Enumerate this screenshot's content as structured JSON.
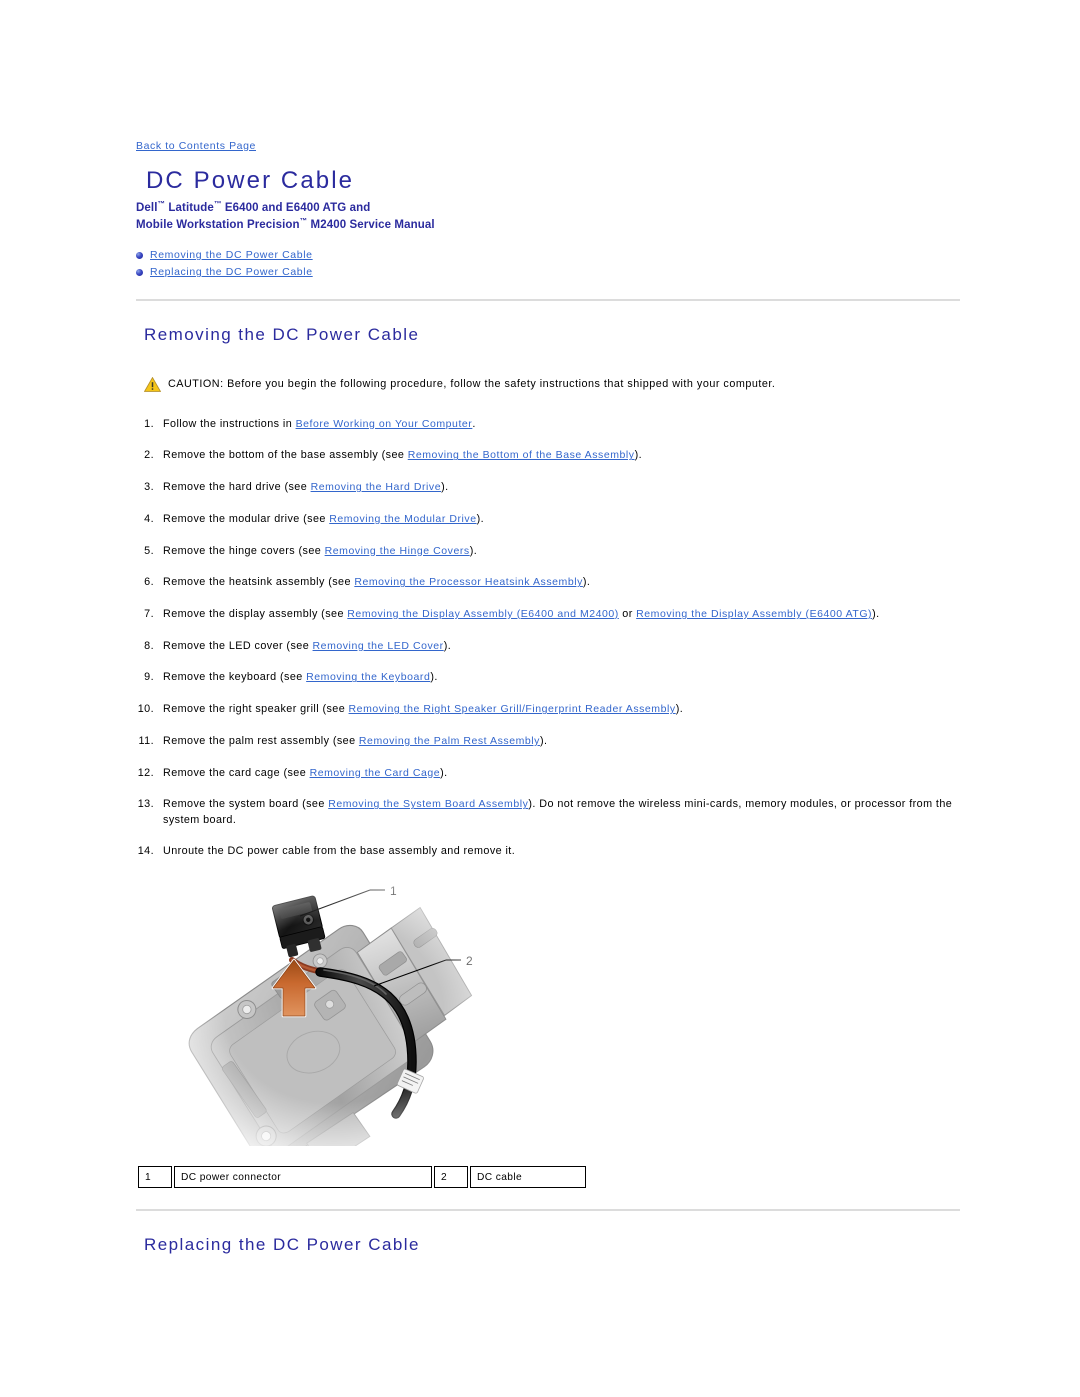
{
  "back_link": "Back to Contents Page",
  "title": "DC Power Cable",
  "subtitle_line1_pre": "Dell",
  "subtitle_line1_mid": " Latitude",
  "subtitle_line1_post": " E6400 and E6400 ATG and",
  "subtitle_line2_pre": "Mobile Workstation Precision",
  "subtitle_line2_post": " M2400 Service Manual",
  "trademark": "™",
  "toc": {
    "items": [
      {
        "label": "Removing the DC Power Cable"
      },
      {
        "label": "Replacing the DC Power Cable"
      }
    ]
  },
  "sections": {
    "removing_heading": "Removing the DC Power Cable",
    "replacing_heading": "Replacing the DC Power Cable"
  },
  "caution": {
    "icon": "warning-triangle-icon",
    "label": "CAUTION:",
    "text": " Before you begin the following procedure, follow the safety instructions that shipped with your computer."
  },
  "steps": [
    {
      "num": "1.",
      "parts": [
        {
          "t": "Follow the instructions in ",
          "link": false
        },
        {
          "t": "Before Working on Your Computer",
          "link": true
        },
        {
          "t": ".",
          "link": false
        }
      ]
    },
    {
      "num": "2.",
      "parts": [
        {
          "t": "Remove the bottom of the base assembly (see ",
          "link": false
        },
        {
          "t": "Removing the Bottom of the Base Assembly",
          "link": true
        },
        {
          "t": ").",
          "link": false
        }
      ]
    },
    {
      "num": "3.",
      "parts": [
        {
          "t": "Remove the hard drive (see ",
          "link": false
        },
        {
          "t": "Removing the Hard Drive",
          "link": true
        },
        {
          "t": ").",
          "link": false
        }
      ]
    },
    {
      "num": "4.",
      "parts": [
        {
          "t": "Remove the modular drive (see ",
          "link": false
        },
        {
          "t": "Removing the Modular Drive",
          "link": true
        },
        {
          "t": ").",
          "link": false
        }
      ]
    },
    {
      "num": "5.",
      "parts": [
        {
          "t": "Remove the hinge covers (see ",
          "link": false
        },
        {
          "t": "Removing the Hinge Covers",
          "link": true
        },
        {
          "t": ").",
          "link": false
        }
      ]
    },
    {
      "num": "6.",
      "parts": [
        {
          "t": "Remove the heatsink assembly (see ",
          "link": false
        },
        {
          "t": "Removing the Processor Heatsink Assembly",
          "link": true
        },
        {
          "t": ").",
          "link": false
        }
      ]
    },
    {
      "num": "7.",
      "parts": [
        {
          "t": "Remove the display assembly (see ",
          "link": false
        },
        {
          "t": "Removing the Display Assembly (E6400 and M2400)",
          "link": true
        },
        {
          "t": " or ",
          "link": false
        },
        {
          "t": "Removing the Display Assembly (E6400 ATG)",
          "link": true
        },
        {
          "t": ").",
          "link": false
        }
      ]
    },
    {
      "num": "8.",
      "parts": [
        {
          "t": "Remove the LED cover (see ",
          "link": false
        },
        {
          "t": "Removing the LED Cover",
          "link": true
        },
        {
          "t": ").",
          "link": false
        }
      ]
    },
    {
      "num": "9.",
      "parts": [
        {
          "t": "Remove the keyboard (see ",
          "link": false
        },
        {
          "t": "Removing the Keyboard",
          "link": true
        },
        {
          "t": ").",
          "link": false
        }
      ]
    },
    {
      "num": "10.",
      "parts": [
        {
          "t": "Remove the right speaker grill (see ",
          "link": false
        },
        {
          "t": "Removing the Right Speaker Grill/Fingerprint Reader Assembly",
          "link": true
        },
        {
          "t": ").",
          "link": false
        }
      ]
    },
    {
      "num": "11.",
      "parts": [
        {
          "t": "Remove the palm rest assembly (see ",
          "link": false
        },
        {
          "t": "Removing the Palm Rest Assembly",
          "link": true
        },
        {
          "t": ").",
          "link": false
        }
      ]
    },
    {
      "num": "12.",
      "parts": [
        {
          "t": "Remove the card cage (see ",
          "link": false
        },
        {
          "t": "Removing the Card Cage",
          "link": true
        },
        {
          "t": ").",
          "link": false
        }
      ]
    },
    {
      "num": "13.",
      "parts": [
        {
          "t": "Remove the system board (see ",
          "link": false
        },
        {
          "t": "Removing the System Board Assembly",
          "link": true
        },
        {
          "t": "). Do not remove the wireless mini-cards, memory modules, or processor from the system board.",
          "link": false
        }
      ]
    },
    {
      "num": "14.",
      "parts": [
        {
          "t": "Unroute the DC power cable from the base assembly and remove it.",
          "link": false
        }
      ]
    }
  ],
  "figure": {
    "alt": "DC power cable routed in laptop base assembly",
    "callouts": [
      {
        "id": "1",
        "target": "dc-power-connector"
      },
      {
        "id": "2",
        "target": "dc-cable"
      }
    ],
    "arrow": "lift-arrow-up"
  },
  "legend": {
    "cells": [
      {
        "num": "1",
        "label": "DC power connector"
      },
      {
        "num": "2",
        "label": "DC cable"
      }
    ]
  },
  "colors": {
    "heading_blue": "#2B2B9E",
    "link_blue": "#3366CC",
    "rule_gray": "#DCDCDC",
    "caution_yellow": "#F5C518",
    "arrow_orange": "#C8682E"
  }
}
